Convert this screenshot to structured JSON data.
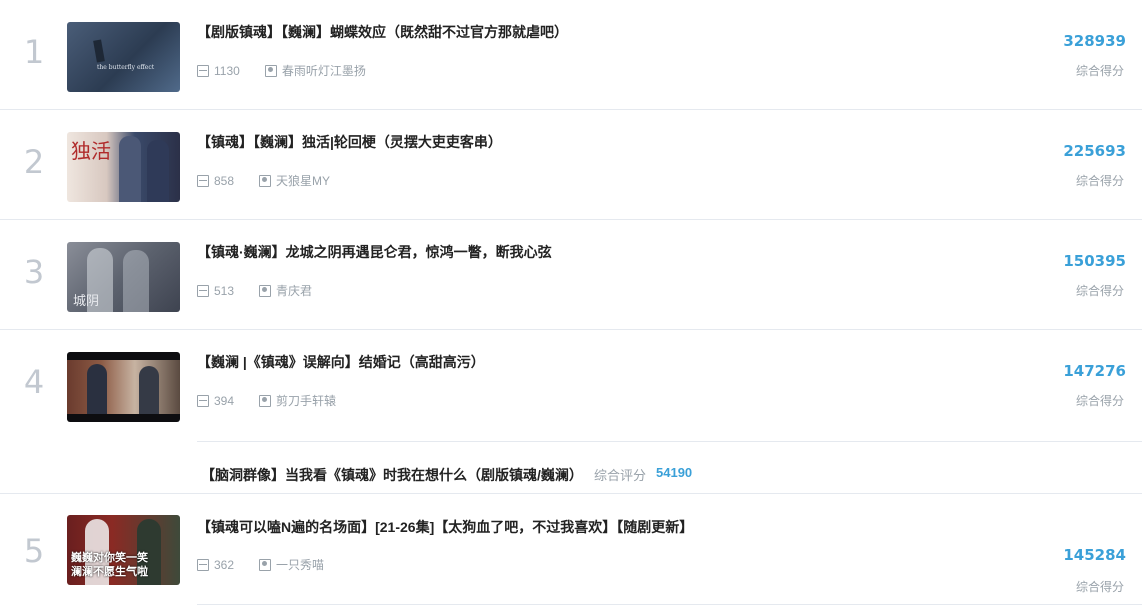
{
  "items": [
    {
      "rank": "1",
      "title": "【剧版镇魂】【巍澜】蝴蝶效应（既然甜不过官方那就虐吧）",
      "plays": "1130",
      "uploader": "春雨听灯江墨扬",
      "score": "328939",
      "score_label": "综合得分",
      "thumb_text": "the butterfly effect"
    },
    {
      "rank": "2",
      "title": "【镇魂】【巍澜】独活|轮回梗（灵摆大吏吏客串）",
      "plays": "858",
      "uploader": "天狼星MY",
      "score": "225693",
      "score_label": "综合得分",
      "thumb_text": "独活"
    },
    {
      "rank": "3",
      "title": "【镇魂·巍澜】龙城之阴再遇昆仑君，惊鸿一瞥，断我心弦",
      "plays": "513",
      "uploader": "青庆君",
      "score": "150395",
      "score_label": "综合得分",
      "thumb_text": "城阴"
    },
    {
      "rank": "4",
      "title": "【巍澜 |《镇魂》误解向】结婚记（高甜高污）",
      "plays": "394",
      "uploader": "剪刀手轩辕",
      "score": "147276",
      "score_label": "综合得分",
      "thumb_text": ""
    },
    {
      "rank": "5",
      "title": "【镇魂可以嗑N遍的名场面】[21-26集]【太狗血了吧，不过我喜欢】【随剧更新】",
      "plays": "362",
      "uploader": "一只秀喵",
      "score": "145284",
      "score_label": "综合得分",
      "thumb_text": "巍巍对你笑一笑\n澜澜不愿生气啦"
    }
  ],
  "related": {
    "title": "【脑洞群像】当我看《镇魂》时我在想什么（剧版镇魂/巍澜）",
    "score_label": "综合评分",
    "score": "54190"
  },
  "colors": {
    "accent": "#3aa0d8",
    "muted": "#99a2aa",
    "rank": "#c2c8d0",
    "divider": "#e5e9ef"
  },
  "icons": {
    "plays": "play-count-icon",
    "uploader": "uploader-icon"
  }
}
